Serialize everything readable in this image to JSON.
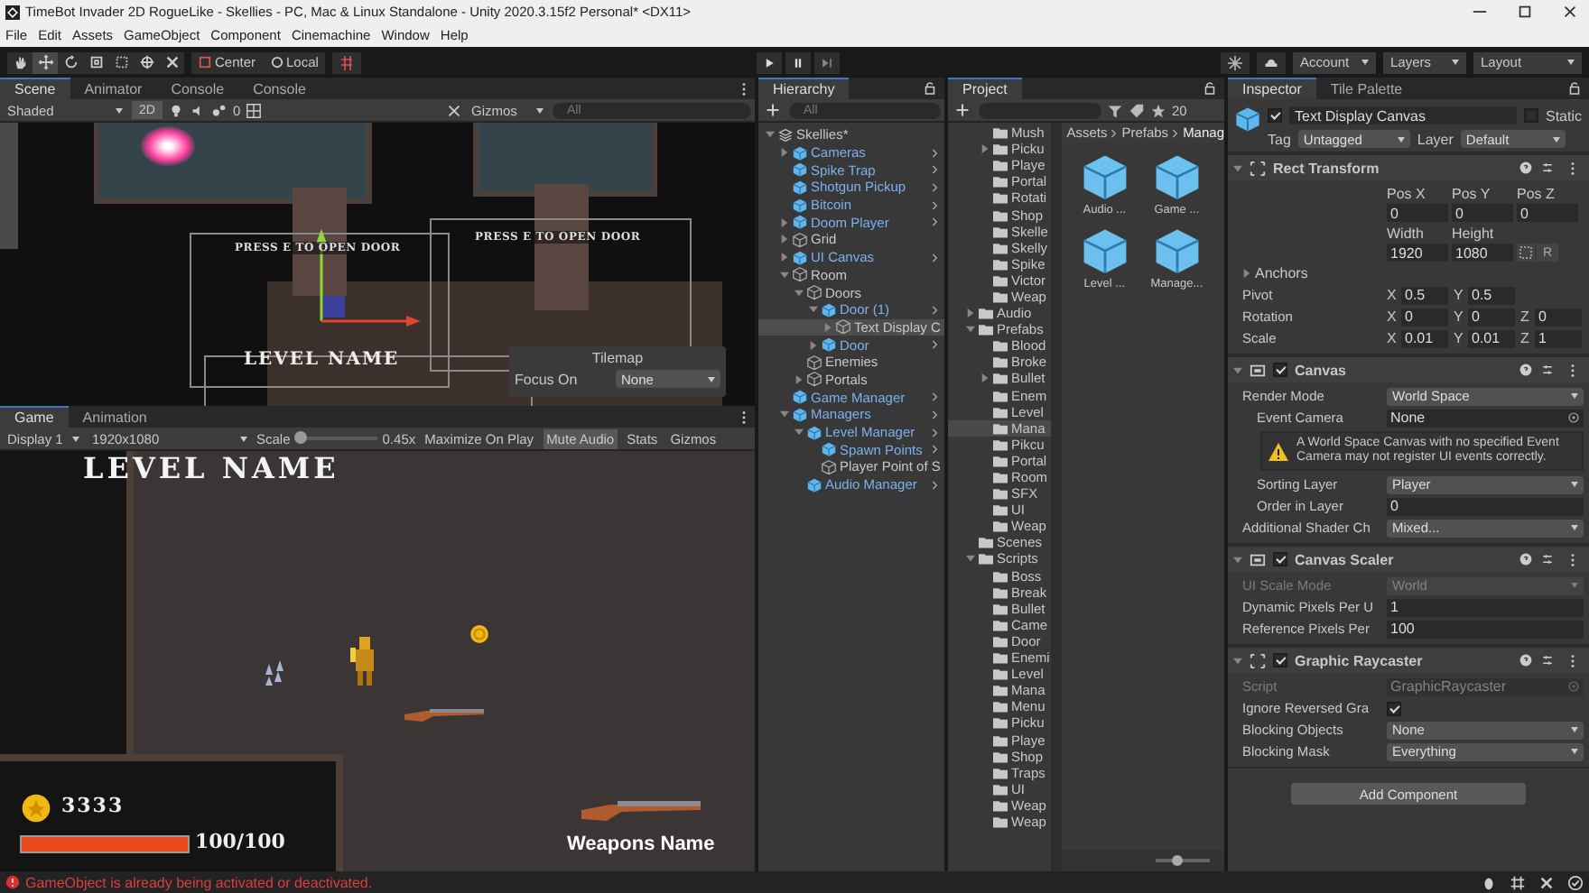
{
  "window": {
    "title": "TimeBot Invader 2D RogueLike - Skellies - PC, Mac & Linux Standalone - Unity 2020.3.15f2 Personal* <DX11>"
  },
  "menu": [
    "File",
    "Edit",
    "Assets",
    "GameObject",
    "Component",
    "Cinemachine",
    "Window",
    "Help"
  ],
  "toolbar": {
    "tools": [
      {
        "kind": "hand",
        "selected": false
      },
      {
        "kind": "move",
        "selected": true
      },
      {
        "kind": "rotate",
        "selected": false
      },
      {
        "kind": "scale",
        "selected": false
      },
      {
        "kind": "rect",
        "selected": false
      },
      {
        "kind": "transform",
        "selected": false
      },
      {
        "kind": "custom",
        "selected": false
      }
    ],
    "pivot": "Center",
    "space": "Local",
    "account": "Account",
    "layers": "Layers",
    "layout": "Layout"
  },
  "scene": {
    "tabs": [
      {
        "label": "Scene",
        "selected": true
      },
      {
        "label": "Animator",
        "selected": false
      },
      {
        "label": "Console",
        "selected": false
      },
      {
        "label": "Console",
        "selected": false
      }
    ],
    "shading": "Shaded",
    "mode_2d": {
      "label": "2D",
      "on": true
    },
    "fx_count": "0",
    "gizmos": "Gizmos",
    "search_placeholder": "All",
    "texts": [
      {
        "kind": "hint",
        "label": "PRESS E TO OPEN DOOR"
      },
      {
        "kind": "hint",
        "label": "PRESS E TO OPEN DOOR"
      },
      {
        "kind": "title",
        "label": "LEVEL NAME"
      }
    ],
    "overlay": {
      "title": "Tilemap",
      "label": "Focus On",
      "value": "None"
    }
  },
  "game": {
    "tabs": [
      {
        "label": "Game",
        "selected": true
      },
      {
        "label": "Animation",
        "selected": false
      }
    ],
    "display": "Display 1",
    "resolution": "1920x1080",
    "scale_label": "Scale",
    "scale": {
      "level": 0.05
    },
    "scale_reading": "0.45x",
    "toggles": [
      {
        "label": "Maximize On Play",
        "on": false
      },
      {
        "label": "Mute Audio",
        "on": true
      },
      {
        "label": "Stats",
        "on": false
      },
      {
        "label": "Gizmos",
        "on": false
      }
    ],
    "hud": {
      "level_name": "LEVEL NAME",
      "coins": "3333",
      "health": {
        "level": 1
      },
      "health_reading": "100/100",
      "weapon_name": "Weapons Name"
    }
  },
  "hierarchy": {
    "title": "Hierarchy",
    "search_placeholder": "All",
    "items": [
      {
        "label": "Skellies*",
        "kind": "scene",
        "expanded": true,
        "children": [
          {
            "label": "Cameras",
            "kind": "prefab",
            "expanded": false
          },
          {
            "label": "Spike Trap",
            "kind": "prefab"
          },
          {
            "label": "Shotgun Pickup",
            "kind": "prefab"
          },
          {
            "label": "Bitcoin",
            "kind": "prefab"
          },
          {
            "label": "Doom Player",
            "kind": "prefab",
            "expanded": false
          },
          {
            "label": "Grid",
            "kind": "object",
            "expanded": false
          },
          {
            "label": "UI Canvas",
            "kind": "prefab",
            "expanded": false
          },
          {
            "label": "Room",
            "kind": "object",
            "expanded": true,
            "children": [
              {
                "label": "Doors",
                "kind": "object",
                "expanded": true,
                "children": [
                  {
                    "label": "Door (1)",
                    "kind": "prefab",
                    "expanded": true,
                    "children": [
                      {
                        "label": "Text Display C",
                        "kind": "object",
                        "expanded": false,
                        "selected": true
                      }
                    ]
                  },
                  {
                    "label": "Door",
                    "kind": "prefab",
                    "expanded": false
                  }
                ]
              },
              {
                "label": "Enemies",
                "kind": "object"
              },
              {
                "label": "Portals",
                "kind": "object",
                "expanded": false
              }
            ]
          },
          {
            "label": "Game Manager",
            "kind": "prefab"
          },
          {
            "label": "Managers",
            "kind": "prefab",
            "expanded": true,
            "children": [
              {
                "label": "Level Manager",
                "kind": "prefab",
                "expanded": true,
                "children": [
                  {
                    "label": "Spawn Points",
                    "kind": "prefab"
                  },
                  {
                    "label": "Player Point of S",
                    "kind": "object"
                  }
                ]
              },
              {
                "label": "Audio Manager",
                "kind": "prefab"
              }
            ]
          }
        ]
      }
    ]
  },
  "project": {
    "title": "Project",
    "count": "20",
    "continued_items": [
      {
        "label": "Mush"
      },
      {
        "label": "Picku",
        "expanded": false
      },
      {
        "label": "Playe"
      },
      {
        "label": "Portal"
      },
      {
        "label": "Rotati"
      },
      {
        "label": "Shop"
      },
      {
        "label": "Skelle"
      },
      {
        "label": "Skelly"
      },
      {
        "label": "Spike"
      },
      {
        "label": "Victor"
      },
      {
        "label": "Weap"
      }
    ],
    "tree": [
      {
        "label": "Audio",
        "expanded": false
      },
      {
        "label": "Prefabs",
        "expanded": true,
        "children": [
          {
            "label": "Blood"
          },
          {
            "label": "Broke"
          },
          {
            "label": "Bullet",
            "expanded": false
          },
          {
            "label": "Enem"
          },
          {
            "label": "Level"
          },
          {
            "label": "Mana",
            "selected": true
          },
          {
            "label": "Pikcu"
          },
          {
            "label": "Portal"
          },
          {
            "label": "Room"
          },
          {
            "label": "SFX"
          },
          {
            "label": "UI"
          },
          {
            "label": "Weap"
          }
        ]
      },
      {
        "label": "Scenes"
      },
      {
        "label": "Scripts",
        "expanded": true,
        "children": [
          {
            "label": "Boss"
          },
          {
            "label": "Break"
          },
          {
            "label": "Bullet"
          },
          {
            "label": "Came"
          },
          {
            "label": "Door"
          },
          {
            "label": "Enemi"
          },
          {
            "label": "Level"
          },
          {
            "label": "Mana"
          },
          {
            "label": "Menu"
          },
          {
            "label": "Picku"
          },
          {
            "label": "Playe"
          },
          {
            "label": "Shop"
          },
          {
            "label": "Traps"
          },
          {
            "label": "UI"
          },
          {
            "label": "Weap"
          },
          {
            "label": "Weap"
          }
        ]
      }
    ],
    "breadcrumb": [
      "Assets",
      "Prefabs",
      "Manag"
    ],
    "assets": [
      "Audio ...",
      "Game ...",
      "Level ...",
      "Manage..."
    ],
    "icon_size": {
      "level": 0.4
    }
  },
  "inspector": {
    "tabs": [
      {
        "label": "Inspector",
        "selected": true
      },
      {
        "label": "Tile Palette",
        "selected": false
      }
    ],
    "object": {
      "name": "Text Display Canvas",
      "active": true,
      "static_label": "Static",
      "static": false,
      "tag_label": "Tag",
      "tag": "Untagged",
      "layer_label": "Layer",
      "layer": "Default"
    },
    "components": [
      {
        "title": "Rect Transform",
        "kind": "rect",
        "rows": [
          {
            "kind": "labels",
            "cells": [
              "Pos X",
              "Pos Y",
              "Pos Z"
            ]
          },
          {
            "kind": "values",
            "cells": [
              "0",
              "0",
              "0"
            ]
          },
          {
            "kind": "labels",
            "cells": [
              "Width",
              "Height"
            ]
          },
          {
            "kind": "values",
            "cells": [
              "1920",
              "1080"
            ],
            "buttons": [
              "R"
            ]
          },
          {
            "kind": "foldout",
            "label": "Anchors",
            "expanded": false
          },
          {
            "kind": "xyz",
            "label": "Pivot",
            "axes": [
              {
                "axis": "X",
                "value": "0.5"
              },
              {
                "axis": "Y",
                "value": "0.5"
              }
            ]
          },
          {
            "kind": "xyz",
            "label": "Rotation",
            "axes": [
              {
                "axis": "X",
                "value": "0"
              },
              {
                "axis": "Y",
                "value": "0"
              },
              {
                "axis": "Z",
                "value": "0"
              }
            ]
          },
          {
            "kind": "xyz",
            "label": "Scale",
            "axes": [
              {
                "axis": "X",
                "value": "0.01"
              },
              {
                "axis": "Y",
                "value": "0.01"
              },
              {
                "axis": "Z",
                "value": "1"
              }
            ]
          }
        ]
      },
      {
        "title": "Canvas",
        "kind": "canvas",
        "enabled": true,
        "rows": [
          {
            "kind": "dropdown",
            "label": "Render Mode",
            "value": "World Space"
          },
          {
            "kind": "object",
            "label": "Event Camera",
            "value": "None",
            "indent": true
          },
          {
            "kind": "warning",
            "label": "A World Space Canvas with no specified Event Camera may not register UI events correctly."
          },
          {
            "kind": "dropdown",
            "label": "Sorting Layer",
            "value": "Player",
            "indent": true
          },
          {
            "kind": "text",
            "label": "Order in Layer",
            "value": "0",
            "indent": true
          },
          {
            "kind": "dropdown",
            "label": "Additional Shader Ch",
            "value": "Mixed..."
          }
        ]
      },
      {
        "title": "Canvas Scaler",
        "kind": "canvas",
        "enabled": true,
        "rows": [
          {
            "kind": "dropdown",
            "label": "UI Scale Mode",
            "value": "World",
            "disabled": true
          },
          {
            "kind": "text",
            "label": "Dynamic Pixels Per U",
            "value": "1"
          },
          {
            "kind": "text",
            "label": "Reference Pixels Per",
            "value": "100"
          }
        ]
      },
      {
        "title": "Graphic Raycaster",
        "kind": "rect",
        "enabled": true,
        "rows": [
          {
            "kind": "object",
            "label": "Script",
            "value": "GraphicRaycaster",
            "disabled": true
          },
          {
            "kind": "checkbox",
            "label": "Ignore Reversed Gra",
            "checked": true
          },
          {
            "kind": "dropdown",
            "label": "Blocking Objects",
            "value": "None"
          },
          {
            "kind": "dropdown",
            "label": "Blocking Mask",
            "value": "Everything"
          }
        ]
      }
    ],
    "add_button": "Add Component"
  },
  "status_bar": {
    "message": "GameObject is already being activated or deactivated."
  }
}
